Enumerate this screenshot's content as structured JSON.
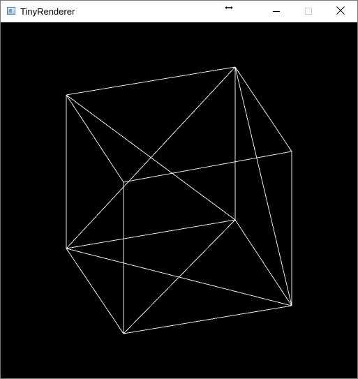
{
  "window": {
    "title": "TinyRenderer",
    "app_icon": "app-window-icon",
    "controls": {
      "minimize_icon": "minimize-icon",
      "maximize_icon": "maximize-icon",
      "close_icon": "close-icon"
    }
  },
  "cursor": {
    "icon": "horizontal-resize-cursor-icon"
  },
  "canvas": {
    "background": "#000000",
    "line_color": "#ffffff",
    "content": "wireframe-cube"
  }
}
